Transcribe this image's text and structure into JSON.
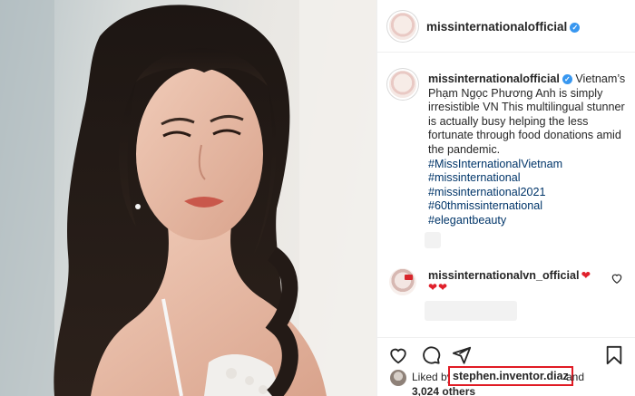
{
  "post": {
    "username": "missinternationalofficial",
    "verified_badge": "✓"
  },
  "caption": {
    "username": "missinternationalofficial",
    "text": "Vietnam’s Phạm Ngọc Phương Anh is simply irresistible ἟b἟3 This multilingual stunner is actually busy helping the less fortunate through food donations amid the pandemic.",
    "text_display": "Vietnam’s Phạm Ngọc Phương Anh is simply irresistible VN This multilingual stunner is actually busy helping the less fortunate through food donations amid the pandemic.",
    "hashtags": [
      "#MissInternationalVietnam",
      "#missinternational",
      "#missinternational2021",
      "#60thmissinternational",
      "#elegantbeauty"
    ]
  },
  "comment": {
    "username": "missinternationalvn_official",
    "inline_hearts": "❤",
    "hearts": "❤❤"
  },
  "likes": {
    "prefix": "Liked by",
    "highlighted_user": "stephen.inventor.diaz",
    "suffix": "and",
    "count": "3,024 others"
  },
  "icons": {
    "like": "heart-icon",
    "comment": "comment-icon",
    "share": "share-icon",
    "save": "bookmark-icon"
  },
  "colors": {
    "hashtag": "#003569",
    "verified": "#3897f0",
    "highlight_box": "#e01b24"
  }
}
